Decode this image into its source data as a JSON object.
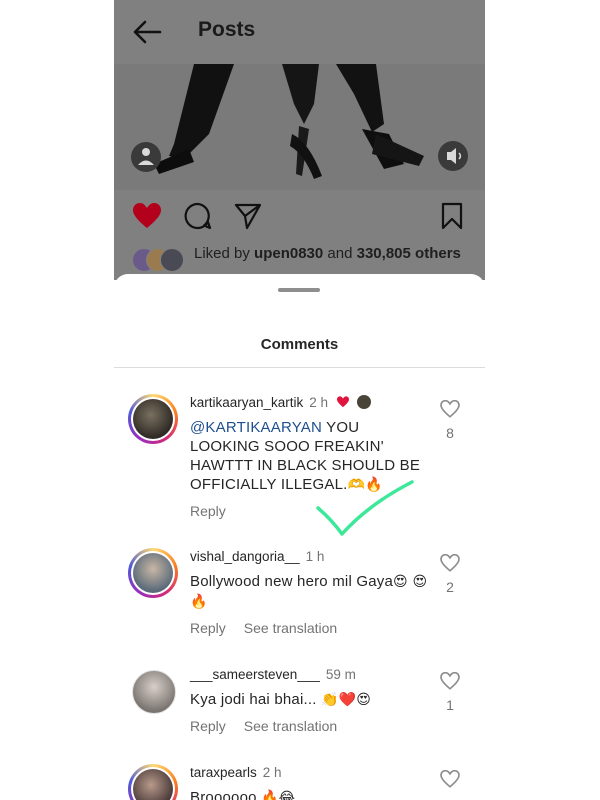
{
  "header": {
    "title": "Posts"
  },
  "post": {
    "likes_prefix": "Liked by",
    "liked_by_user": "upen0830",
    "likes_and": "and",
    "likes_count": "330,805",
    "likes_suffix": "others"
  },
  "sheet": {
    "title": "Comments"
  },
  "comments": [
    {
      "username": "kartikaaryan_kartik",
      "time": "2 h",
      "mention": "@KARTIKAARYAN",
      "text": " YOU LOOKING SOOO FREAKIN' HAWTTT IN BLACK SHOULD BE OFFICIALLY ILLEGAL.",
      "emoji": "🫶🔥",
      "reply_label": "Reply",
      "like_count": "8"
    },
    {
      "username": "vishal_dangoria__",
      "time": "1 h",
      "text": "Bollywood new hero mil Gaya",
      "emoji": "😍 😍🔥",
      "reply_label": "Reply",
      "translate_label": "See translation",
      "like_count": "2"
    },
    {
      "username": "___sameersteven___",
      "time": "59 m",
      "text": "Kya jodi hai bhai...",
      "emoji": "👏❤️😍",
      "reply_label": "Reply",
      "translate_label": "See translation",
      "like_count": "1"
    },
    {
      "username": "taraxpearls",
      "time": "2 h",
      "text": "Broooooo",
      "emoji": "🔥😂",
      "like_count": ""
    }
  ],
  "colors": {
    "heart_liked": "#b3001b",
    "overlay": "#808080",
    "check_mark": "#3ee89a"
  }
}
